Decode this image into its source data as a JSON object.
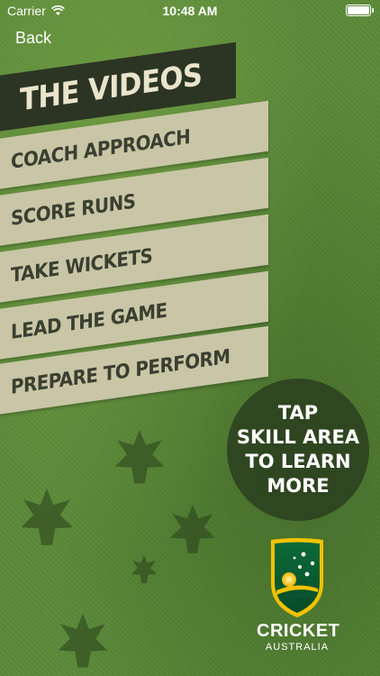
{
  "status_bar": {
    "carrier": "Carrier",
    "time": "10:48 AM"
  },
  "nav": {
    "back_label": "Back"
  },
  "menu": {
    "title": "THE VIDEOS",
    "items": [
      {
        "label": "COACH APPROACH"
      },
      {
        "label": "SCORE RUNS"
      },
      {
        "label": "TAKE WICKETS"
      },
      {
        "label": "LEAD THE GAME"
      },
      {
        "label": "PREPARE TO PERFORM"
      }
    ]
  },
  "callout": {
    "lines": [
      "TAP",
      "SKILL AREA",
      "TO LEARN",
      "MORE"
    ]
  },
  "logo": {
    "title": "CRICKET",
    "subtitle": "AUSTRALIA"
  },
  "colors": {
    "grass": "#5b8a38",
    "title_panel": "#2c3424",
    "item_panel": "#c8c6a6",
    "item_text": "#3a3f30",
    "circle": "#283a1e"
  }
}
